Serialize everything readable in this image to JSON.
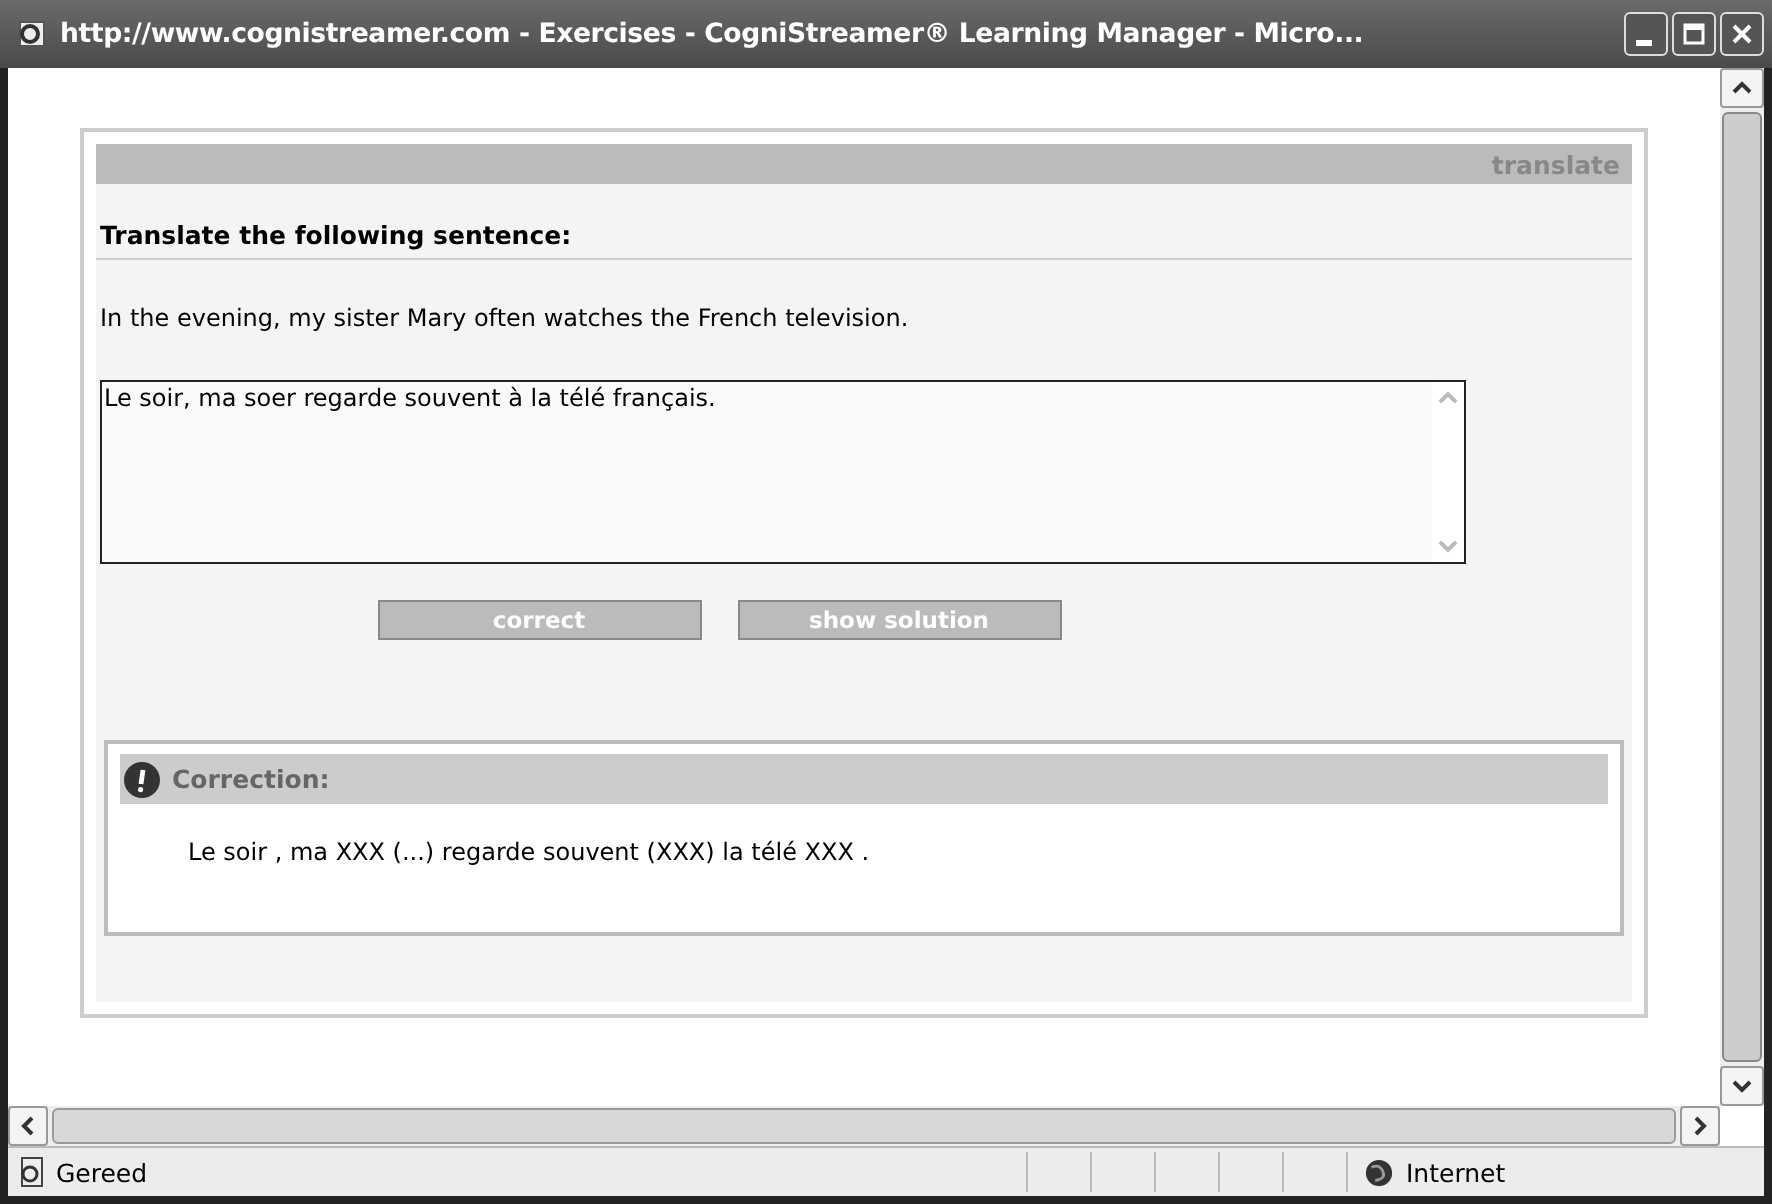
{
  "window": {
    "title": "http://www.cognistreamer.com - Exercises - CogniStreamer® Learning Manager - Micro..."
  },
  "exercise": {
    "type_label": "translate",
    "instruction": "Translate the following sentence:",
    "sentence": "In the evening, my sister Mary often watches the French television.",
    "answer": "Le soir, ma soer regarde souvent à la télé français.",
    "buttons": [
      {
        "label": "correct"
      },
      {
        "label": "show solution"
      }
    ],
    "correction": {
      "title": "Correction:",
      "text": "Le soir , ma XXX (...) regarde souvent (XXX) la télé XXX ."
    }
  },
  "status_bar": {
    "text": "Gereed",
    "zone": "Internet"
  }
}
